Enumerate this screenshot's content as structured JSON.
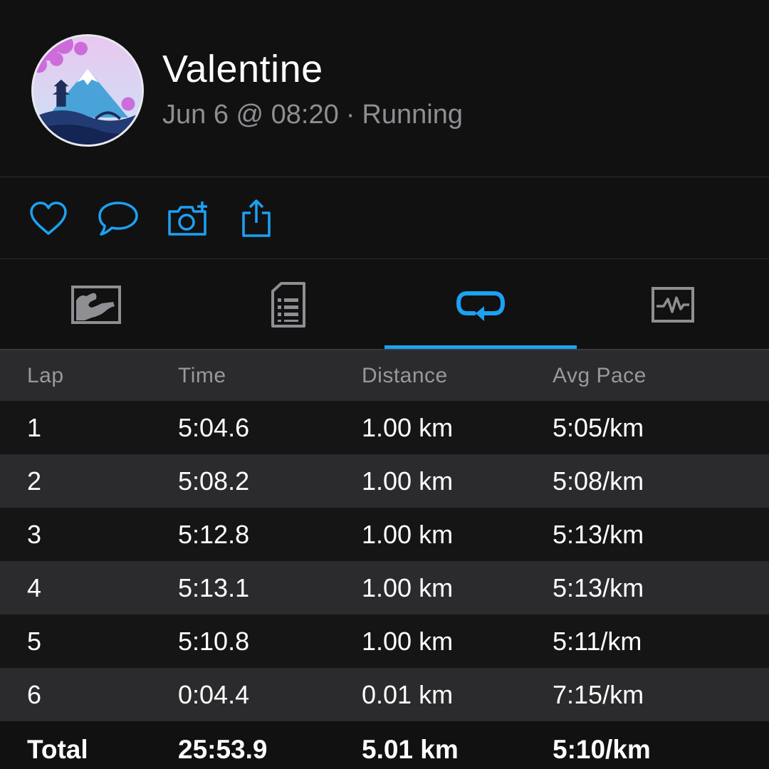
{
  "profile": {
    "name": "Valentine",
    "date_time": "Jun 6 @ 08:20",
    "separator": "·",
    "activity_type": "Running",
    "avatar_icon": "mountain-landscape-avatar"
  },
  "actions": [
    {
      "icon": "heart-icon",
      "label": "Like"
    },
    {
      "icon": "comment-icon",
      "label": "Comment"
    },
    {
      "icon": "add-photo-icon",
      "label": "Add Photo"
    },
    {
      "icon": "share-icon",
      "label": "Share"
    }
  ],
  "tabs": [
    {
      "icon": "map-icon",
      "active": false
    },
    {
      "icon": "document-list-icon",
      "active": false
    },
    {
      "icon": "laps-loop-icon",
      "active": true
    },
    {
      "icon": "chart-pulse-icon",
      "active": false
    }
  ],
  "colors": {
    "accent": "#1da1f2",
    "background": "#111112",
    "row_alt": "#2b2b2d",
    "muted_text": "#8e8e93"
  },
  "laps_table": {
    "headers": [
      "Lap",
      "Time",
      "Distance",
      "Avg Pace"
    ],
    "rows": [
      [
        "1",
        "5:04.6",
        "1.00 km",
        "5:05/km"
      ],
      [
        "2",
        "5:08.2",
        "1.00 km",
        "5:08/km"
      ],
      [
        "3",
        "5:12.8",
        "1.00 km",
        "5:13/km"
      ],
      [
        "4",
        "5:13.1",
        "1.00 km",
        "5:13/km"
      ],
      [
        "5",
        "5:10.8",
        "1.00 km",
        "5:11/km"
      ],
      [
        "6",
        "0:04.4",
        "0.01 km",
        "7:15/km"
      ]
    ],
    "total": [
      "Total",
      "25:53.9",
      "5.01 km",
      "5:10/km"
    ]
  }
}
